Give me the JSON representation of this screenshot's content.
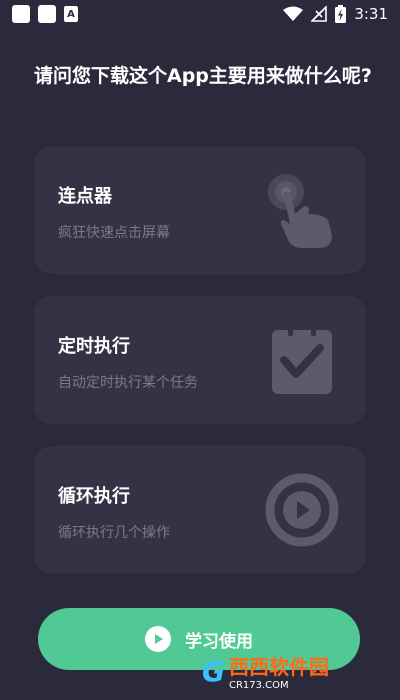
{
  "status_bar": {
    "time": "3:31",
    "left_icons": [
      "notification-square-icon",
      "notification-square-icon",
      "a-badge-icon"
    ],
    "a_badge": "A",
    "right_icons": [
      "wifi-icon",
      "signal-icon",
      "battery-icon"
    ]
  },
  "headline": "请问您下载这个App主要用来做什么呢?",
  "options": [
    {
      "title": "连点器",
      "subtitle": "疯狂快速点击屏幕",
      "icon": "tap-hand-icon"
    },
    {
      "title": "定时执行",
      "subtitle": "自动定时执行某个任务",
      "icon": "clipboard-check-icon"
    },
    {
      "title": "循环执行",
      "subtitle": "循环执行几个操作",
      "icon": "play-circle-icon"
    }
  ],
  "learn_button": {
    "label": "学习使用",
    "icon": "play-icon"
  },
  "watermark": {
    "logo": "G",
    "name": "西西软件园",
    "url": "CR173.COM"
  },
  "colors": {
    "background": "#2b2a3d",
    "card": "#343346",
    "accent": "#50c994",
    "subtitle": "#7a7a8c"
  }
}
